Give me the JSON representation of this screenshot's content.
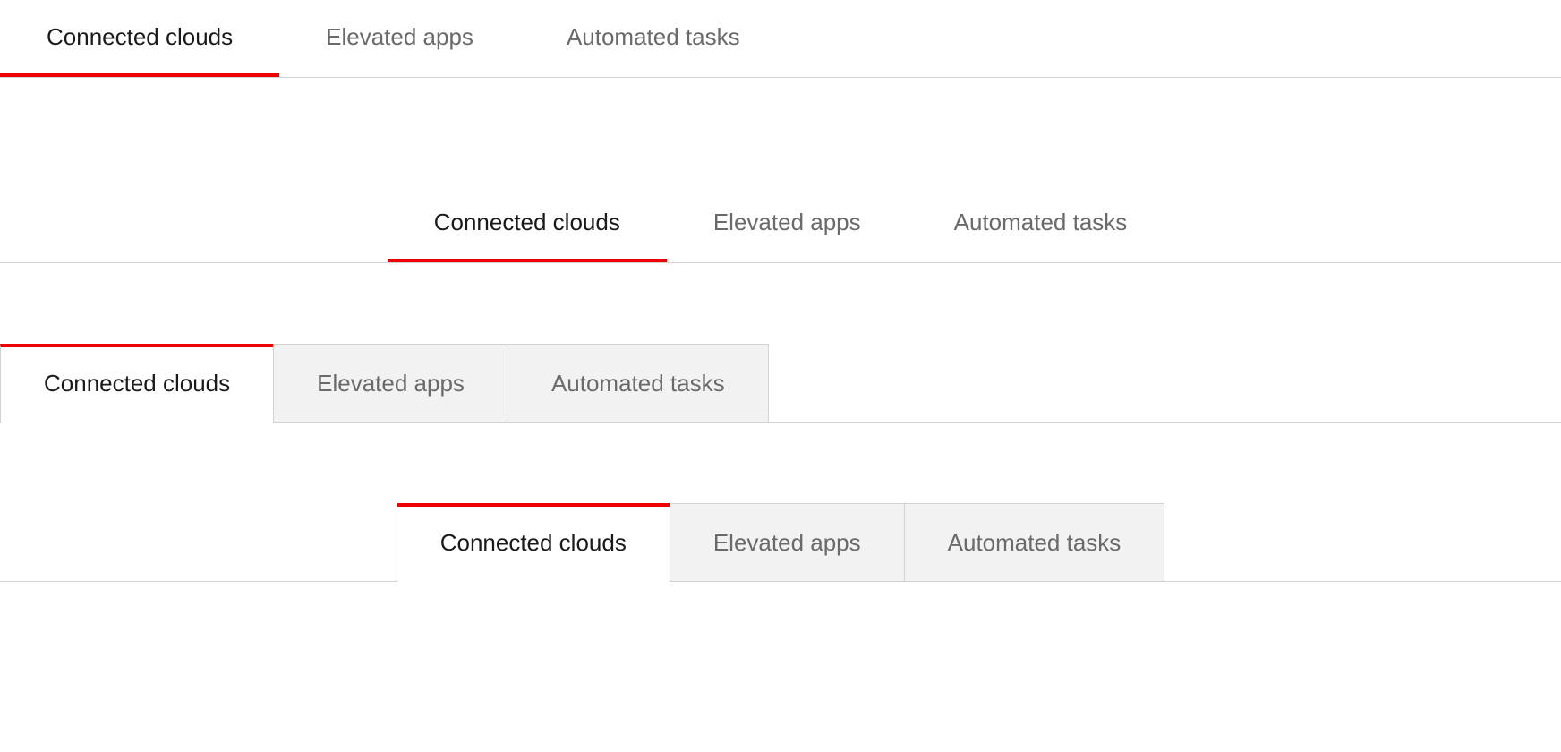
{
  "tab_labels": {
    "connected_clouds": "Connected clouds",
    "elevated_apps": "Elevated apps",
    "automated_tasks": "Automated tasks"
  }
}
